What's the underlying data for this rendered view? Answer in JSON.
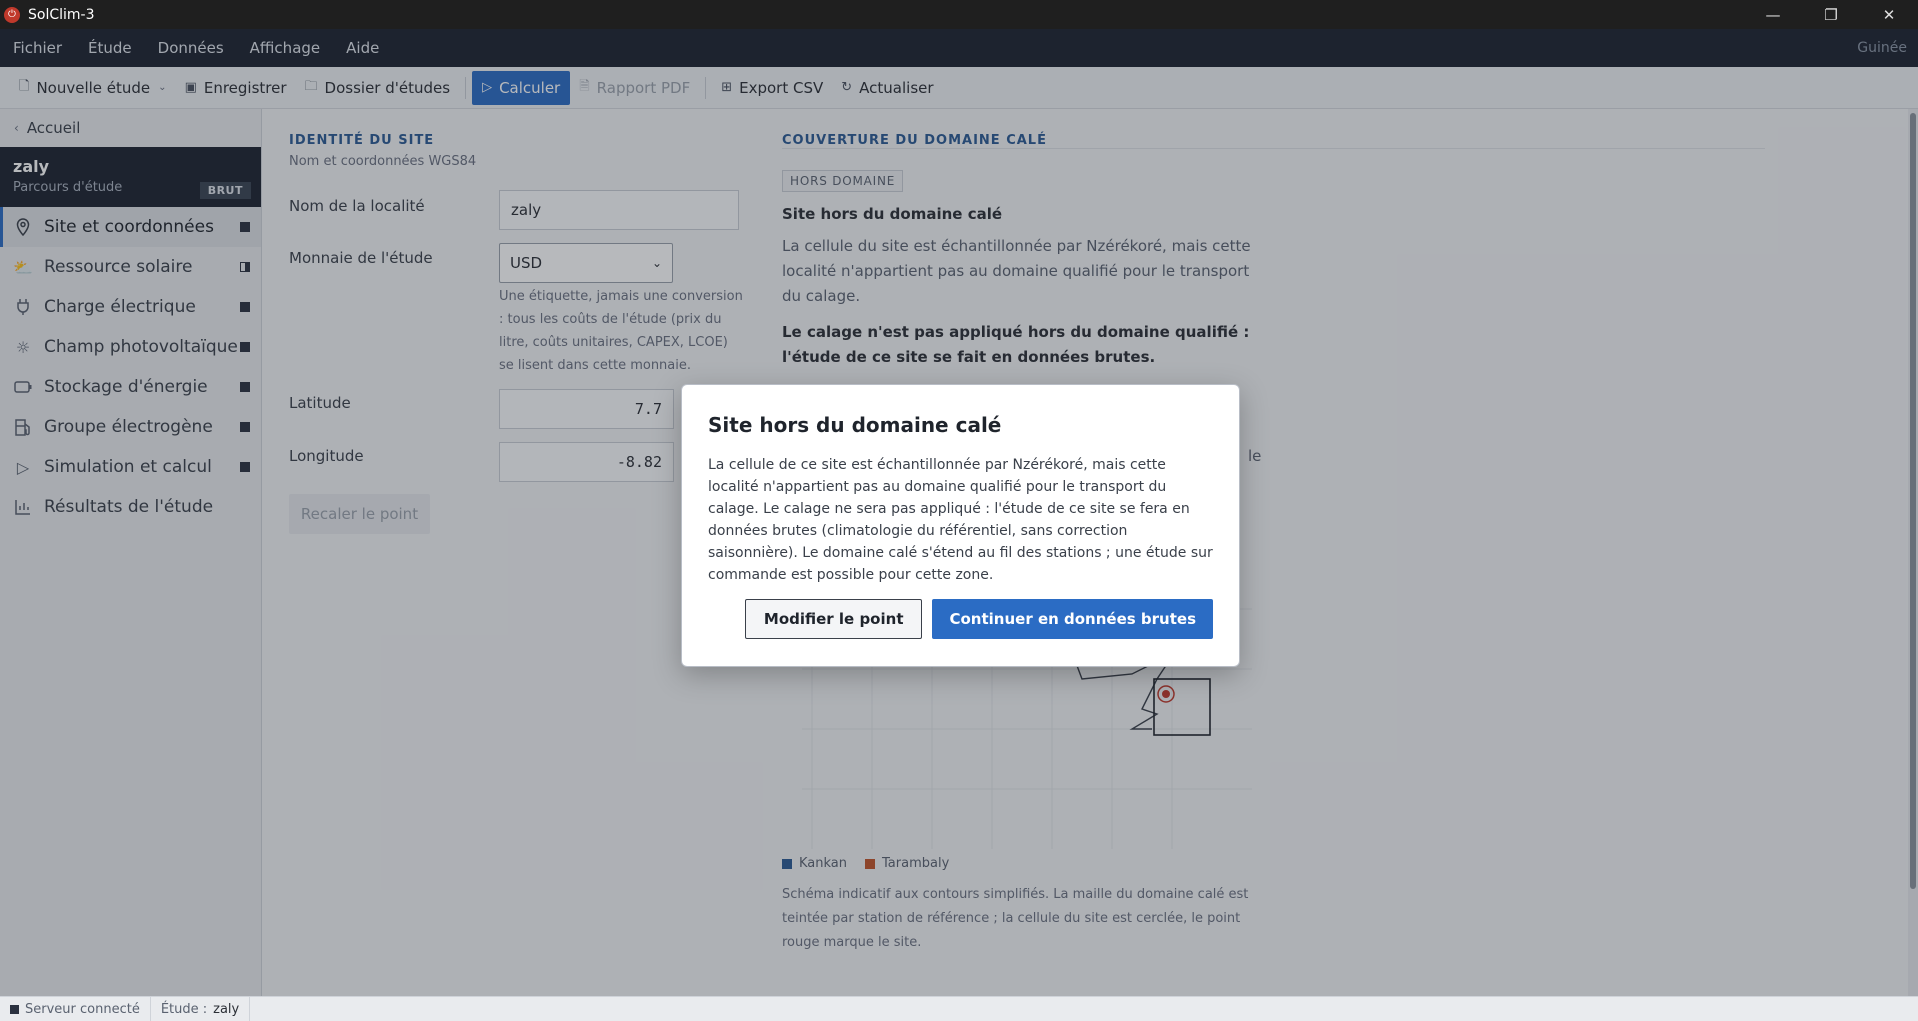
{
  "window": {
    "title": "SolClim-3",
    "minimize": "—",
    "maximize": "❐",
    "close": "✕"
  },
  "menu": {
    "items": [
      "Fichier",
      "Étude",
      "Données",
      "Affichage",
      "Aide"
    ],
    "region": "Guinée"
  },
  "toolbar": {
    "new_study": "Nouvelle étude",
    "save": "Enregistrer",
    "studies_folder": "Dossier d'études",
    "calculate": "Calculer",
    "pdf_report": "Rapport PDF",
    "export_csv": "Export CSV",
    "refresh": "Actualiser"
  },
  "sidebar": {
    "back": "Accueil",
    "study_name": "zaly",
    "study_sub": "Parcours d'étude",
    "badge": "BRUT",
    "items": [
      {
        "label": "Site et coordonnées",
        "icon": "pin-icon",
        "status": "done"
      },
      {
        "label": "Ressource solaire",
        "icon": "sun-cloud-icon",
        "status": "partial"
      },
      {
        "label": "Charge électrique",
        "icon": "plug-icon",
        "status": "done"
      },
      {
        "label": "Champ photovoltaïque",
        "icon": "sun-icon",
        "status": "done"
      },
      {
        "label": "Stockage d'énergie",
        "icon": "battery-icon",
        "status": "done"
      },
      {
        "label": "Groupe électrogène",
        "icon": "fuel-icon",
        "status": "done"
      },
      {
        "label": "Simulation et calcul",
        "icon": "play-icon",
        "status": "done"
      },
      {
        "label": "Résultats de l'étude",
        "icon": "chart-icon",
        "status": ""
      }
    ]
  },
  "identity": {
    "title": "IDENTITÉ DU SITE",
    "subtitle": "Nom et coordonnées WGS84",
    "locality_label": "Nom de la localité",
    "locality_value": "zaly",
    "currency_label": "Monnaie de l'étude",
    "currency_value": "USD",
    "currency_help": "Une étiquette, jamais une conversion : tous les coûts de l'étude (prix du litre, coûts unitaires, CAPEX, LCOE) se lisent dans cette monnaie.",
    "latitude_label": "Latitude",
    "latitude_value": "7.7",
    "longitude_label": "Longitude",
    "longitude_value": "-8.82",
    "recalibrate": "Recaler le point"
  },
  "coverage": {
    "title": "COUVERTURE DU DOMAINE CALÉ",
    "tag": "HORS DOMAINE",
    "heading": "Site hors du domaine calé",
    "text": "La cellule du site est échantillonnée par Nzérékoré, mais cette localité n'appartient pas au domaine qualifié pour le transport du calage.",
    "strong": "Le calage n'est pas appliqué hors du domaine qualifié : l'étude de ce site se fait en données brutes.",
    "partial_line_end": "le",
    "legend": [
      {
        "name": "Kankan",
        "color": "#2b5a94"
      },
      {
        "name": "Tarambaly",
        "color": "#c2552a"
      }
    ],
    "caption": "Schéma indicatif aux contours simplifiés. La maille du domaine calé est teintée par station de référence ; la cellule du site est cerclée, le point rouge marque le site."
  },
  "modal": {
    "title": "Site hors du domaine calé",
    "body": "La cellule de ce site est échantillonnée par Nzérékoré, mais cette localité n'appartient pas au domaine qualifié pour le transport du calage. Le calage ne sera pas appliqué : l'étude de ce site se fera en données brutes (climatologie du référentiel, sans correction saisonnière). Le domaine calé s'étend au fil des stations ; une étude sur commande est possible pour cette zone.",
    "secondary": "Modifier le point",
    "primary": "Continuer en données brutes"
  },
  "status": {
    "server": "Serveur connecté",
    "study_prefix": "Étude :",
    "study": "zaly"
  }
}
